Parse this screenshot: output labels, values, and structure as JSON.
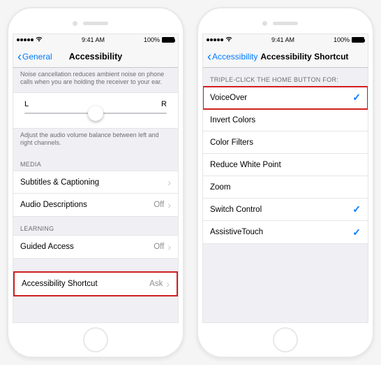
{
  "left": {
    "status": {
      "time": "9:41 AM",
      "battery": "100%"
    },
    "nav": {
      "back": "General",
      "title": "Accessibility"
    },
    "noise_hint": "Noise cancellation reduces ambient noise on phone calls when you are holding the receiver to your ear.",
    "slider": {
      "left": "L",
      "right": "R"
    },
    "balance_hint": "Adjust the audio volume balance between left and right channels.",
    "sections": {
      "media": "MEDIA",
      "learning": "LEARNING"
    },
    "rows": {
      "subtitles": "Subtitles & Captioning",
      "audio_desc": {
        "label": "Audio Descriptions",
        "value": "Off"
      },
      "guided": {
        "label": "Guided Access",
        "value": "Off"
      },
      "shortcut": {
        "label": "Accessibility Shortcut",
        "value": "Ask"
      }
    }
  },
  "right": {
    "status": {
      "time": "9:41 AM",
      "battery": "100%"
    },
    "nav": {
      "back": "Accessibility",
      "title": "Accessibility Shortcut"
    },
    "header": "TRIPLE-CLICK THE HOME BUTTON FOR:",
    "items": [
      {
        "label": "VoiceOver",
        "checked": true,
        "highlight": true
      },
      {
        "label": "Invert Colors",
        "checked": false
      },
      {
        "label": "Color Filters",
        "checked": false
      },
      {
        "label": "Reduce White Point",
        "checked": false
      },
      {
        "label": "Zoom",
        "checked": false
      },
      {
        "label": "Switch Control",
        "checked": true
      },
      {
        "label": "AssistiveTouch",
        "checked": true
      }
    ]
  }
}
